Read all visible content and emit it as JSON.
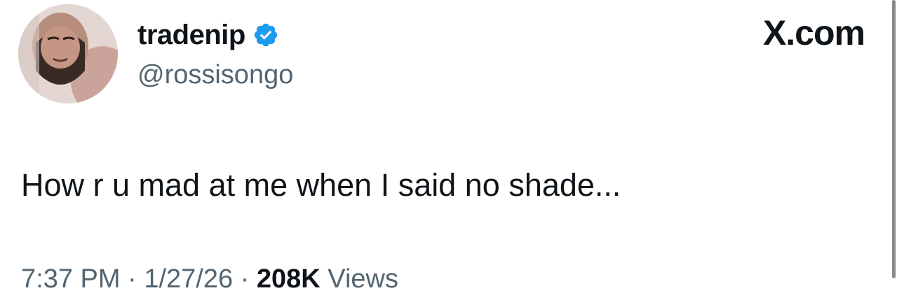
{
  "post": {
    "author": {
      "display_name": "tradenip",
      "handle": "@rossisongo",
      "verified": true,
      "avatar_icon": "profile-photo"
    },
    "brand_label": "X.com",
    "text": "How r u mad at me when I said no shade...",
    "meta": {
      "time": "7:37 PM",
      "date": "1/27/26",
      "separator": " · ",
      "views_count": "208K",
      "views_label": "Views"
    }
  },
  "colors": {
    "primary_text": "#0f1419",
    "secondary_text": "#536471",
    "verified_blue": "#1d9bf0"
  }
}
